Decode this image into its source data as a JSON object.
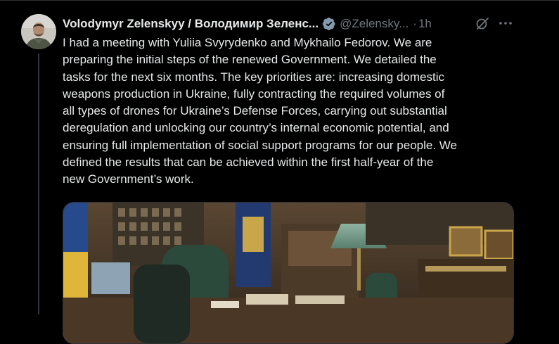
{
  "post": {
    "author": {
      "display_name": "Volodymyr Zelenskyy / Володимир Зеленс...",
      "handle": "@Zelensky...",
      "verified": true,
      "avatar_icon": "avatar-photo"
    },
    "separator": "·",
    "time": "1h",
    "text": "I had a meeting with Yuliia Svyrydenko and Mykhailo Fedorov. We are\npreparing the initial steps of the renewed Government. We detailed the\ntasks for the next six months. The key priorities are: increasing domestic\nweapons production in Ukraine, fully contracting the required volumes of\nall types of drones for Ukraine’s Defense Forces, carrying out substantial\nderegulation and unlocking our country’s internal economic potential, and\nensuring full implementation of social support programs for our people. We\ndefined the results that can be achieved within the first half-year of the\nnew Government’s work.",
    "media": {
      "type": "photo",
      "icon": "office-meeting-photo"
    }
  },
  "icons": {
    "verified": "verified-badge-icon",
    "translate": "grok-translate-icon",
    "more": "more-options-icon"
  },
  "colors": {
    "background": "#000000",
    "text": "#e7e9ea",
    "muted": "#71767b",
    "verified": "#829aab",
    "border": "#2f3336"
  }
}
